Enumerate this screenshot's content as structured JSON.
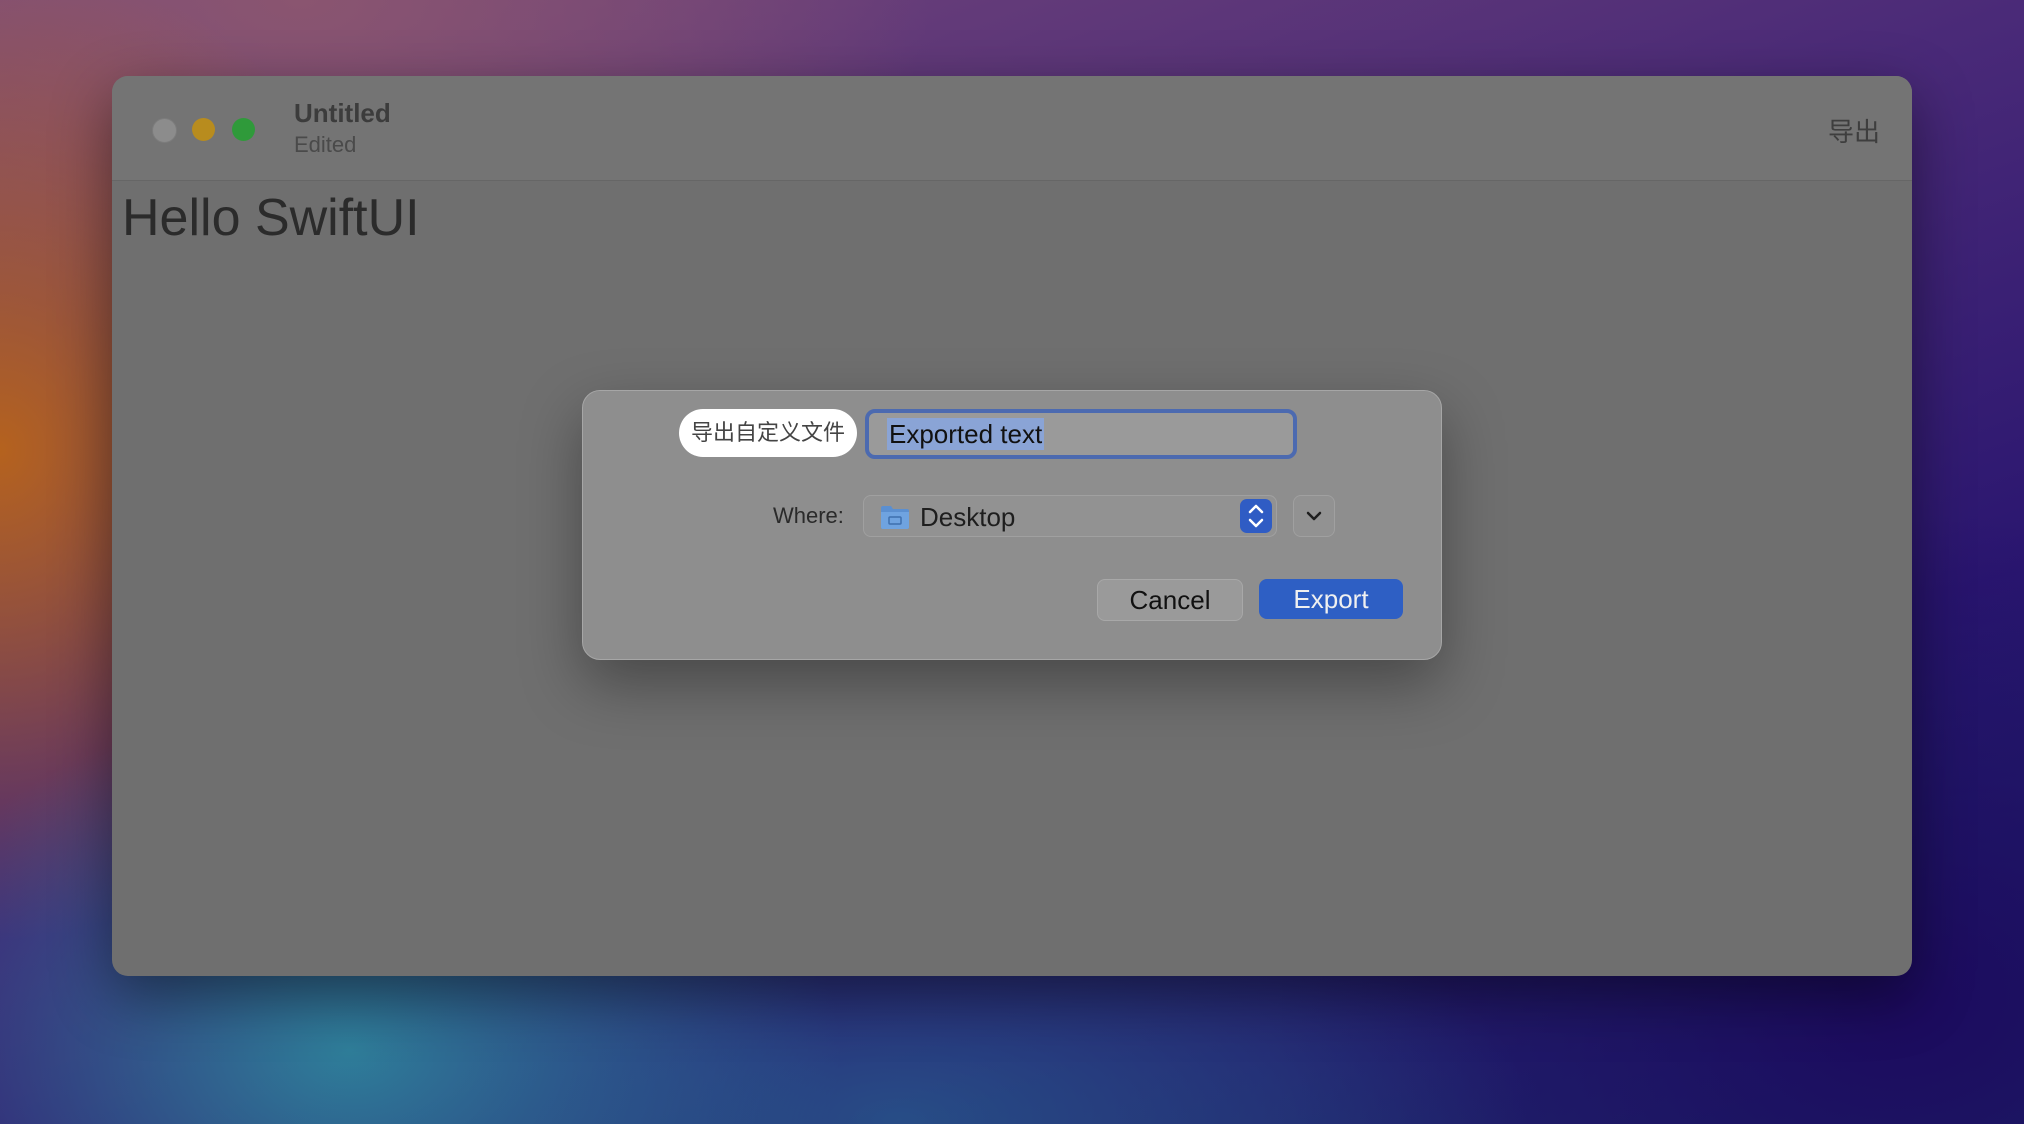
{
  "window": {
    "title": "Untitled",
    "subtitle": "Edited",
    "toolbar_export_label": "导出"
  },
  "content": {
    "text": "Hello SwiftUI"
  },
  "dialog": {
    "name_label": "导出自定义文件",
    "name_value": "Exported text",
    "where_label": "Where:",
    "where_value": "Desktop",
    "cancel_label": "Cancel",
    "export_label": "Export"
  },
  "colors": {
    "accent": "#2e5fc4",
    "close": "#8c8c8c",
    "minimize": "#b88c1e",
    "maximize": "#2f9a3a"
  },
  "icons": {
    "folder": "folder-icon",
    "stepper": "chevron-updown-icon",
    "expand": "chevron-down-icon"
  }
}
